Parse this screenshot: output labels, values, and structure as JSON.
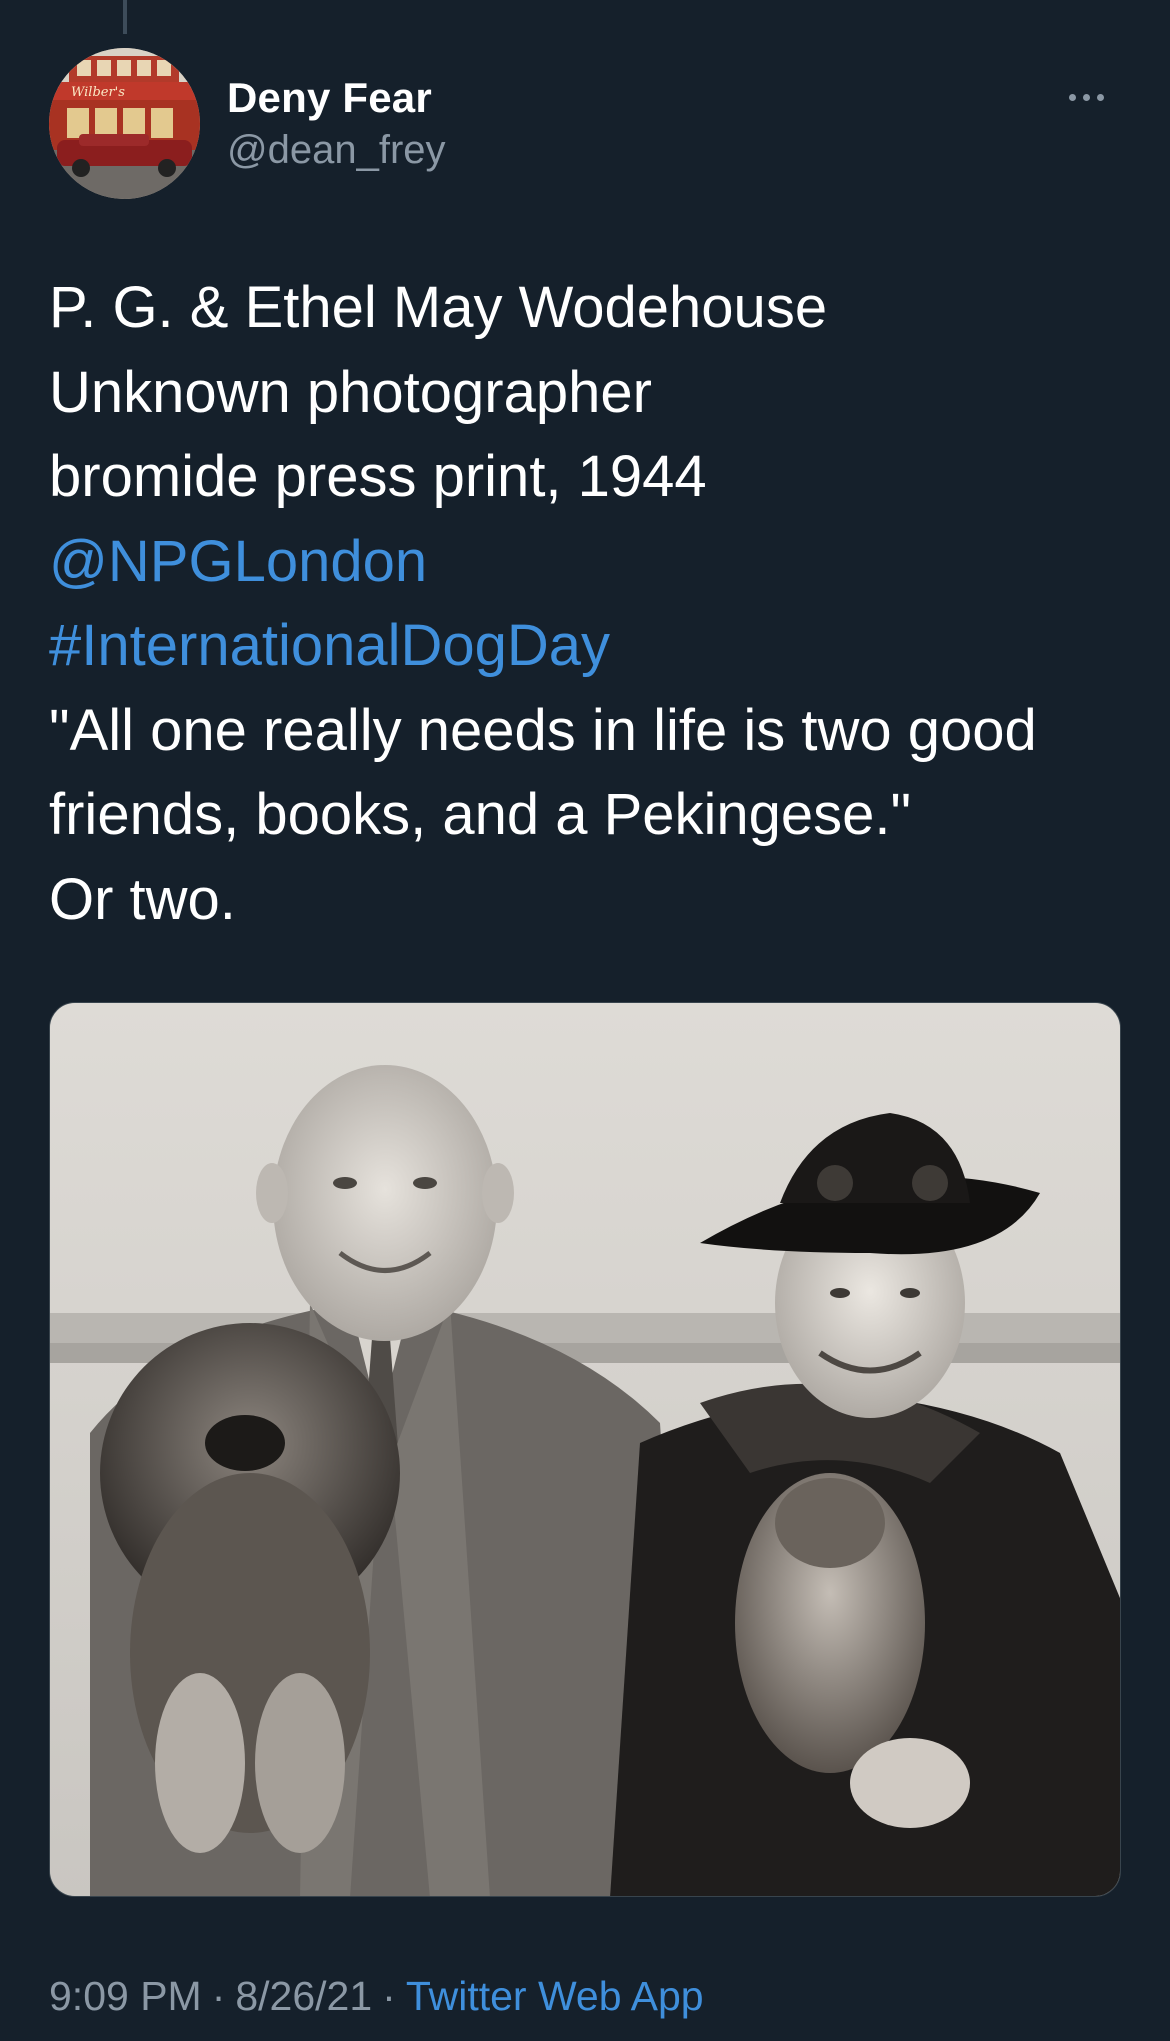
{
  "author": {
    "name": "Deny Fear",
    "handle": "@dean_frey",
    "avatar_sign_text": "Wilber's"
  },
  "tweet": {
    "lines": [
      "P. G. & Ethel May Wodehouse",
      "Unknown photographer",
      "bromide press print, 1944"
    ],
    "mention": "@NPGLondon",
    "hashtag": "#InternationalDogDay",
    "quote_lines": [
      "\"All one really needs in life is two good",
      "friends, books, and a Pekingese.\"",
      "Or two."
    ]
  },
  "media": {
    "kind": "black-and-white photograph",
    "icon": "photo-image"
  },
  "meta": {
    "time": "9:09 PM",
    "date": "8/26/21",
    "separator": "·",
    "source": "Twitter Web App"
  },
  "icons": {
    "more": "more-dots-icon"
  },
  "colors": {
    "background": "#15202b",
    "link": "#3f8fdc",
    "secondary_text": "#8b98a5"
  }
}
